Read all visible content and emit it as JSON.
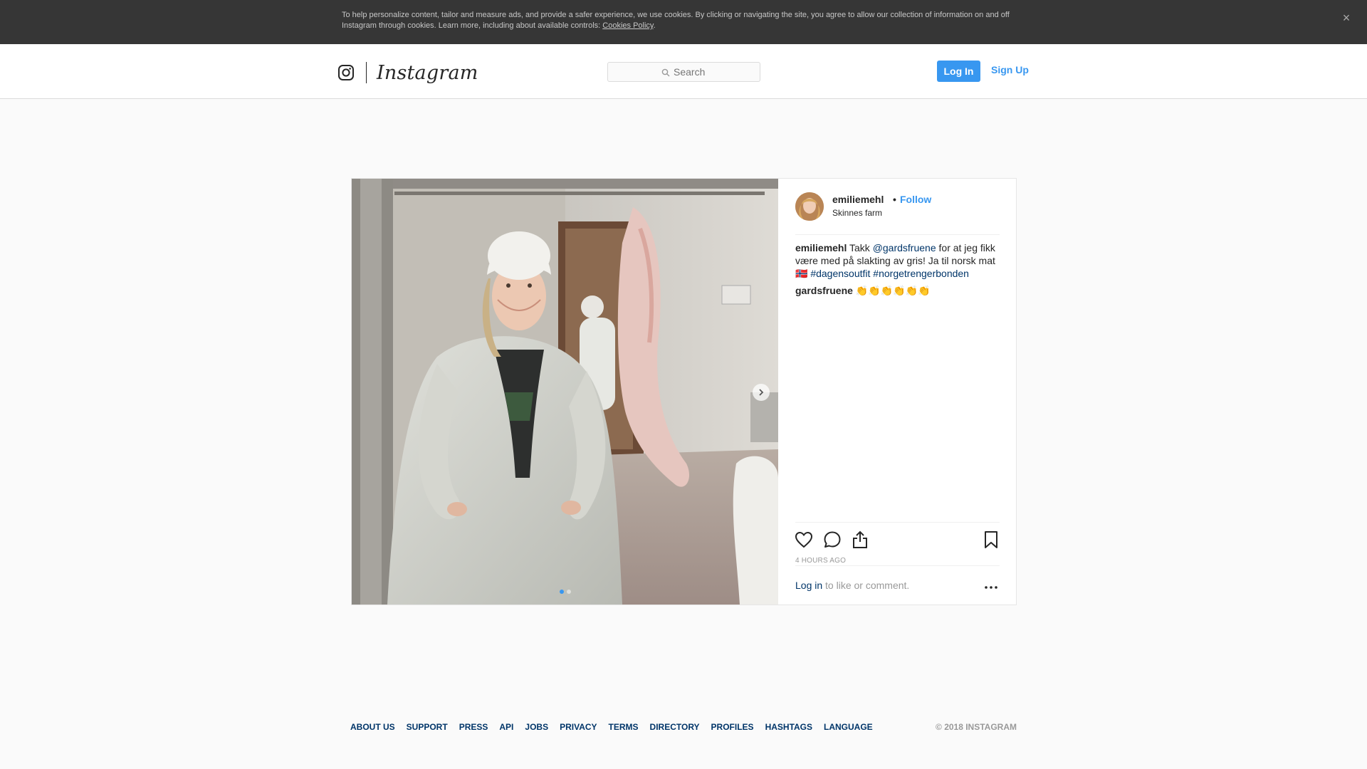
{
  "cookie_banner": {
    "text": "To help personalize content, tailor and measure ads, and provide a safer experience, we use cookies. By clicking or navigating the site, you agree to allow our collection of information on and off Instagram through cookies. Learn more, including about available controls: ",
    "policy_link": "Cookies Policy",
    "trailing": ".",
    "close_icon": "×"
  },
  "header": {
    "wordmark": "Instagram",
    "search_placeholder": "Search",
    "login_label": "Log In",
    "signup_label": "Sign Up"
  },
  "post": {
    "username": "emiliemehl",
    "separator": "•",
    "follow_label": "Follow",
    "location": "Skinnes farm",
    "caption": {
      "user": "emiliemehl",
      "text_1": " Takk ",
      "mention": "@gardsfruene",
      "text_2": " for at jeg fikk være med på slakting av gris! Ja til norsk mat ",
      "emoji": "🇳🇴",
      "text_3": " ",
      "tag_1": "#dagensoutfit",
      "text_4": " ",
      "tag_2": "#norgetrengerbonden"
    },
    "reply": {
      "user": "gardsfruene",
      "text": " 👏👏👏👏👏👏"
    },
    "timestamp": "4 hours ago",
    "login_prompt_link": "Log in",
    "login_prompt_text": " to like or comment.",
    "carousel": {
      "current": 1,
      "total": 2
    }
  },
  "footer": {
    "links": [
      "About us",
      "Support",
      "Press",
      "API",
      "Jobs",
      "Privacy",
      "Terms",
      "Directory",
      "Profiles",
      "Hashtags",
      "Language"
    ],
    "copyright": "© 2018 Instagram"
  },
  "colors": {
    "accent": "#3897f0",
    "link_dark": "#003569",
    "banner_bg": "#363636"
  }
}
